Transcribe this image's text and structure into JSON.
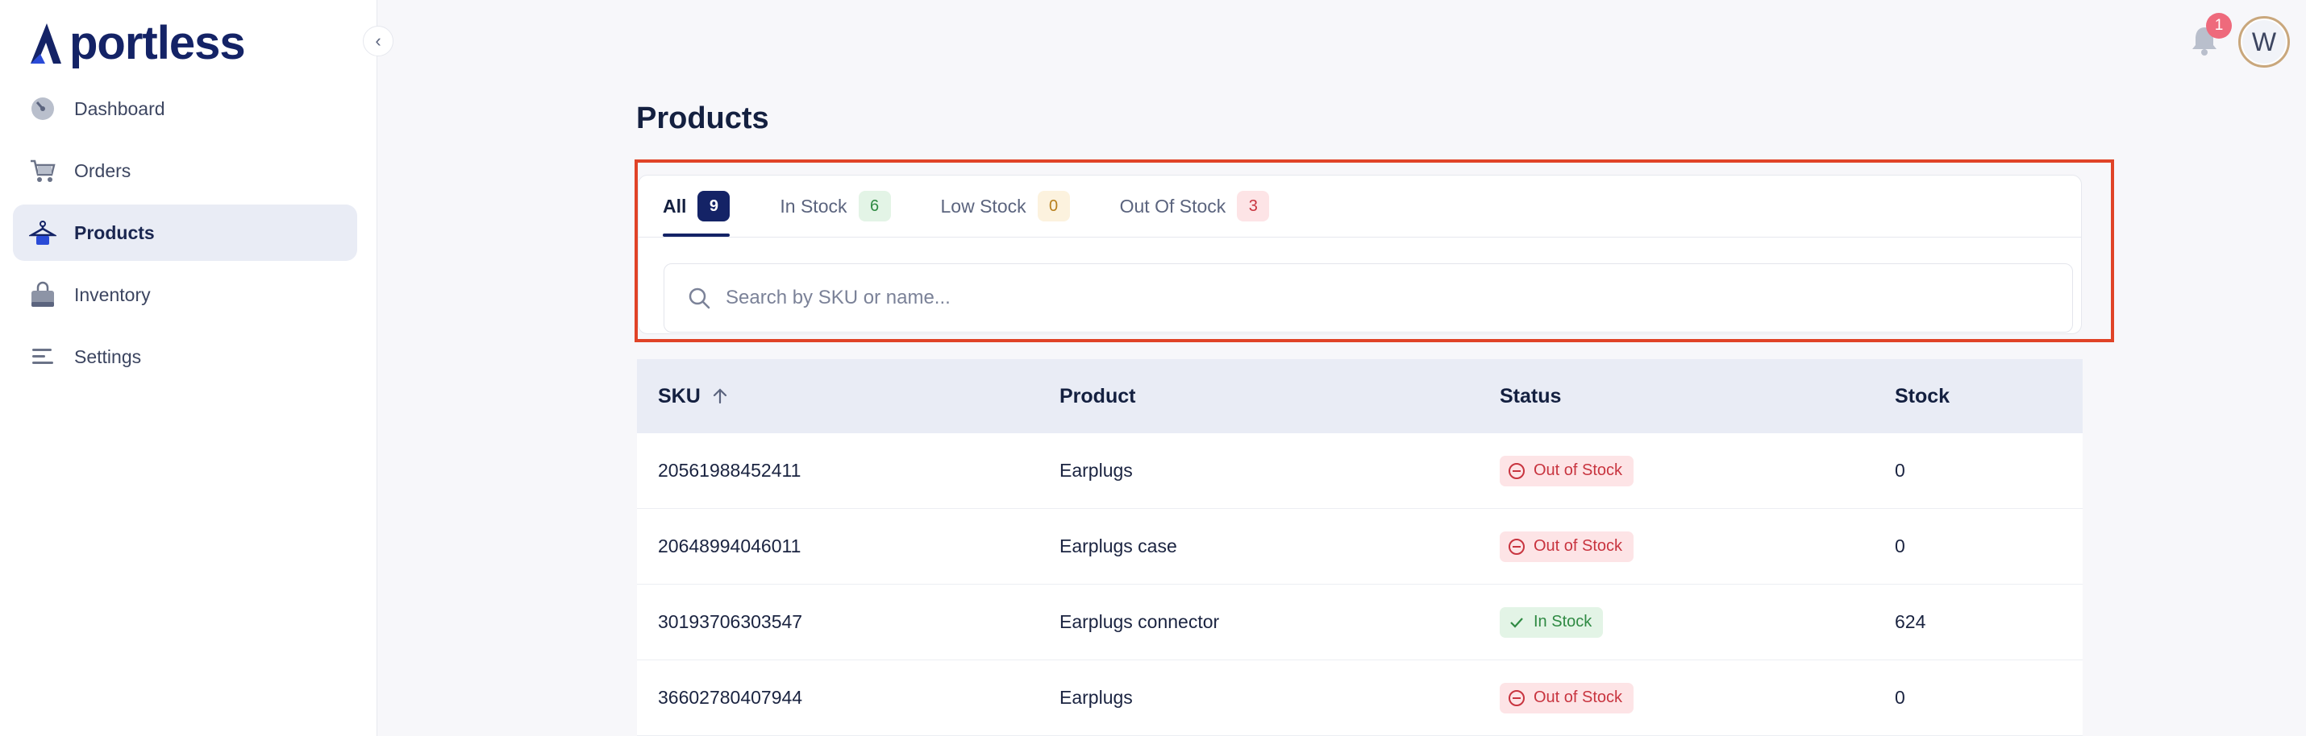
{
  "brand": {
    "name": "portless",
    "color": "#142366"
  },
  "sidebar": {
    "items": [
      {
        "label": "Dashboard",
        "icon": "dashboard-icon",
        "active": false
      },
      {
        "label": "Orders",
        "icon": "cart-icon",
        "active": false
      },
      {
        "label": "Products",
        "icon": "hanger-icon",
        "active": true
      },
      {
        "label": "Inventory",
        "icon": "bag-icon",
        "active": false
      },
      {
        "label": "Settings",
        "icon": "settings-lines-icon",
        "active": false
      }
    ]
  },
  "header": {
    "notifications_count": "1",
    "avatar_initial": "W"
  },
  "main": {
    "title": "Products",
    "tabs": [
      {
        "label": "All",
        "count": "9",
        "active": true
      },
      {
        "label": "In Stock",
        "count": "6"
      },
      {
        "label": "Low Stock",
        "count": "0"
      },
      {
        "label": "Out Of Stock",
        "count": "3"
      }
    ],
    "search": {
      "placeholder": "Search by SKU or name..."
    },
    "table": {
      "columns": [
        "SKU",
        "Product",
        "Status",
        "Stock"
      ],
      "rows": [
        {
          "sku": "20561988452411",
          "product": "Earplugs",
          "status": "Out of Stock",
          "stock": "0"
        },
        {
          "sku": "20648994046011",
          "product": "Earplugs case",
          "status": "Out of Stock",
          "stock": "0"
        },
        {
          "sku": "30193706303547",
          "product": "Earplugs connector",
          "status": "In Stock",
          "stock": "624"
        },
        {
          "sku": "36602780407944",
          "product": "Earplugs",
          "status": "Out of Stock",
          "stock": "0"
        }
      ]
    }
  },
  "colors": {
    "highlight": "#e04327",
    "out_of_stock": "#c8343f",
    "in_stock": "#2f8a43",
    "low_stock": "#b8801e"
  }
}
